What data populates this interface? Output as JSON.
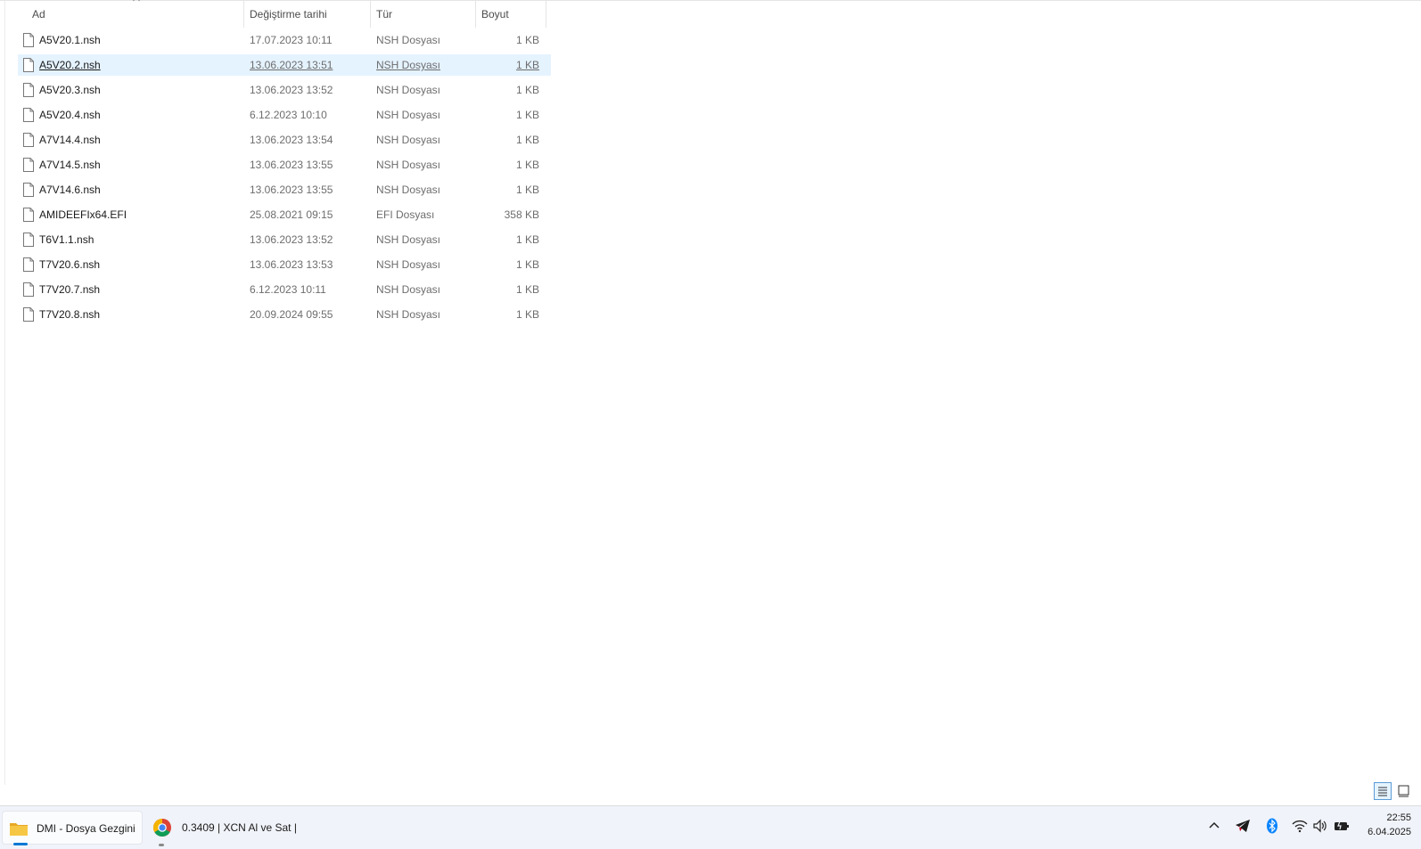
{
  "columns": {
    "name": "Ad",
    "modified": "Değiştirme tarihi",
    "type": "Tür",
    "size": "Boyut"
  },
  "files": [
    {
      "name": "A5V20.1.nsh",
      "modified": "17.07.2023 10:11",
      "type": "NSH Dosyası",
      "size": "1 KB",
      "selected": false
    },
    {
      "name": "A5V20.2.nsh",
      "modified": "13.06.2023 13:51",
      "type": "NSH Dosyası",
      "size": "1 KB",
      "selected": true
    },
    {
      "name": "A5V20.3.nsh",
      "modified": "13.06.2023 13:52",
      "type": "NSH Dosyası",
      "size": "1 KB",
      "selected": false
    },
    {
      "name": "A5V20.4.nsh",
      "modified": "6.12.2023 10:10",
      "type": "NSH Dosyası",
      "size": "1 KB",
      "selected": false
    },
    {
      "name": "A7V14.4.nsh",
      "modified": "13.06.2023 13:54",
      "type": "NSH Dosyası",
      "size": "1 KB",
      "selected": false
    },
    {
      "name": "A7V14.5.nsh",
      "modified": "13.06.2023 13:55",
      "type": "NSH Dosyası",
      "size": "1 KB",
      "selected": false
    },
    {
      "name": "A7V14.6.nsh",
      "modified": "13.06.2023 13:55",
      "type": "NSH Dosyası",
      "size": "1 KB",
      "selected": false
    },
    {
      "name": "AMIDEEFIx64.EFI",
      "modified": "25.08.2021 09:15",
      "type": "EFI Dosyası",
      "size": "358 KB",
      "selected": false
    },
    {
      "name": "T6V1.1.nsh",
      "modified": "13.06.2023 13:52",
      "type": "NSH Dosyası",
      "size": "1 KB",
      "selected": false
    },
    {
      "name": "T7V20.6.nsh",
      "modified": "13.06.2023 13:53",
      "type": "NSH Dosyası",
      "size": "1 KB",
      "selected": false
    },
    {
      "name": "T7V20.7.nsh",
      "modified": "6.12.2023 10:11",
      "type": "NSH Dosyası",
      "size": "1 KB",
      "selected": false
    },
    {
      "name": "T7V20.8.nsh",
      "modified": "20.09.2024 09:55",
      "type": "NSH Dosyası",
      "size": "1 KB",
      "selected": false
    }
  ],
  "taskbar": {
    "items": [
      {
        "label": "DMI - Dosya Gezgini",
        "icon": "folder-icon",
        "active": true
      },
      {
        "label": "0.3409 | XCN Al ve Sat |",
        "icon": "chrome-icon",
        "active": false
      }
    ],
    "tray_icons": [
      "chevron-up-icon",
      "telegram-icon",
      "bluetooth-icon",
      "wifi-icon",
      "volume-icon",
      "battery-icon"
    ],
    "clock": {
      "time": "22:55",
      "date": "6.04.2025"
    }
  },
  "colors": {
    "selection": "#e5f3ff",
    "accent": "#0078d4",
    "folder": "#f3c13a",
    "telegram": "#d0021b",
    "bluetooth": "#0a84ff"
  }
}
